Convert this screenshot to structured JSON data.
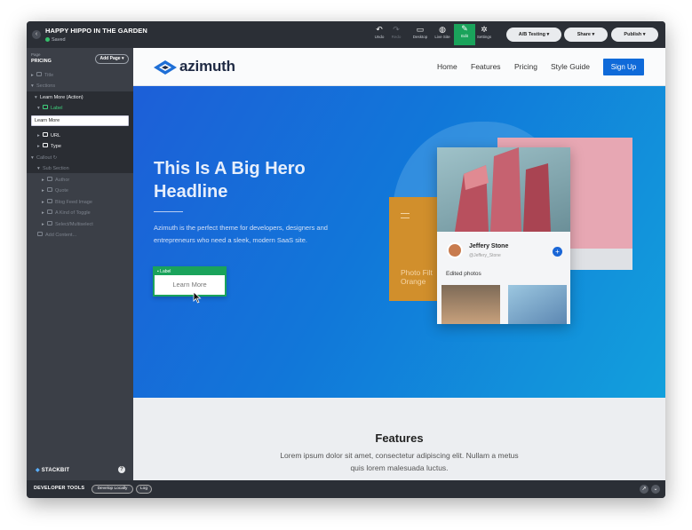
{
  "app": {
    "title": "HAPPY HIPPO IN THE GARDEN",
    "status": "Saved",
    "back_icon": "chevron-left-icon"
  },
  "toolbar": {
    "undo": "Undo",
    "redo": "Redo",
    "desktop": "Desktop",
    "live_site": "Live Site",
    "edit": "Edit",
    "settings": "Settings",
    "ab_testing": "A/B Testing ▾",
    "share": "Share ▾",
    "publish": "Publish ▾"
  },
  "sidebar": {
    "page_label": "Page",
    "page_value": "PRICING",
    "add_page": "Add Page ▾",
    "tree": {
      "title": "Title",
      "sections": "Sections",
      "learn_more": "Learn More (Action)",
      "label": "Label",
      "label_input_value": "Learn More",
      "url": "URL",
      "type": "Type",
      "callout": "Callout",
      "sub_section": "Sub Section",
      "author": "Author",
      "quote": "Quote",
      "blog_feed_image": "Blog Feed Image",
      "kind_of_toggle": "A Kind of Toggle",
      "select_multiselect": "Select/Multiselect",
      "add_content": "Add Content..."
    },
    "brand": "STACKBIT",
    "help": "?"
  },
  "bottom": {
    "dev_tools": "DEVELOPER TOOLS",
    "develop_locally": "Develop Locally",
    "log": "Log"
  },
  "site": {
    "logo_text": "azimuth",
    "nav": [
      "Home",
      "Features",
      "Pricing",
      "Style Guide"
    ],
    "signup": "Sign Up",
    "hero": {
      "headline": "This Is A Big Hero\nHeadline",
      "text": "Azimuth is the perfect theme for developers, designers and entrepreneurs who need a sleek, modern SaaS site.",
      "button_tag": "Label",
      "button": "Learn More"
    },
    "illustration": {
      "orange_text": "Photo Filt\nOrange",
      "card_name": "Jeffery Stone",
      "card_handle": "@Jeffery_Stone",
      "card_section": "Edited photos",
      "plus": "+"
    },
    "features": {
      "title": "Features",
      "text": "Lorem ipsum dolor sit amet, consectetur adipiscing elit. Nullam a metus quis lorem malesuada luctus."
    }
  },
  "colors": {
    "accent_green": "#1aa35b",
    "brand_blue": "#0f6ad9"
  }
}
